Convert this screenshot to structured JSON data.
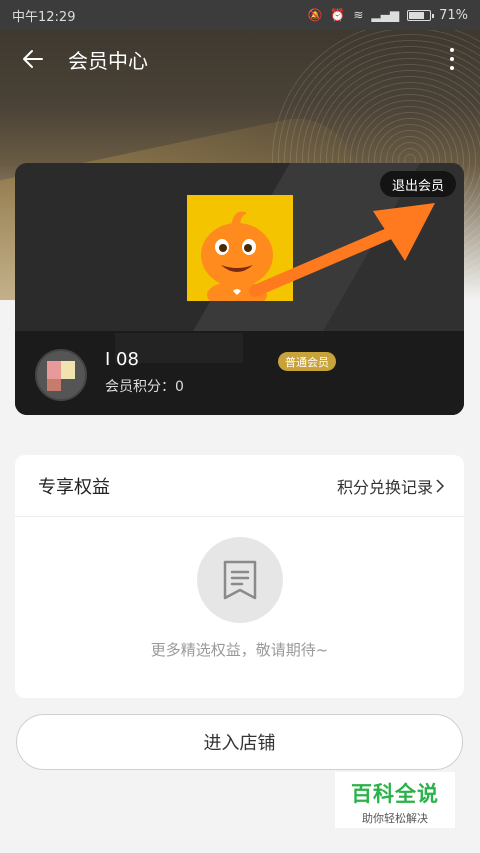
{
  "status_bar": {
    "time": "中午12:29",
    "battery": "71%"
  },
  "nav": {
    "title": "会员中心"
  },
  "member_card": {
    "quit_label": "退出会员",
    "username": "I                 08",
    "level": "普通会员",
    "points_label": "会员积分：0"
  },
  "benefits": {
    "title": "专享权益",
    "link": "积分兑换记录",
    "empty_text": "更多精选权益，敬请期待~"
  },
  "store_button": "进入店铺",
  "watermark": {
    "title": "百科全说",
    "subtitle": "助你轻松解决"
  },
  "colors": {
    "badge": "#c8a23a",
    "arrow": "#ff7a1f",
    "watermark": "#2db24a"
  }
}
